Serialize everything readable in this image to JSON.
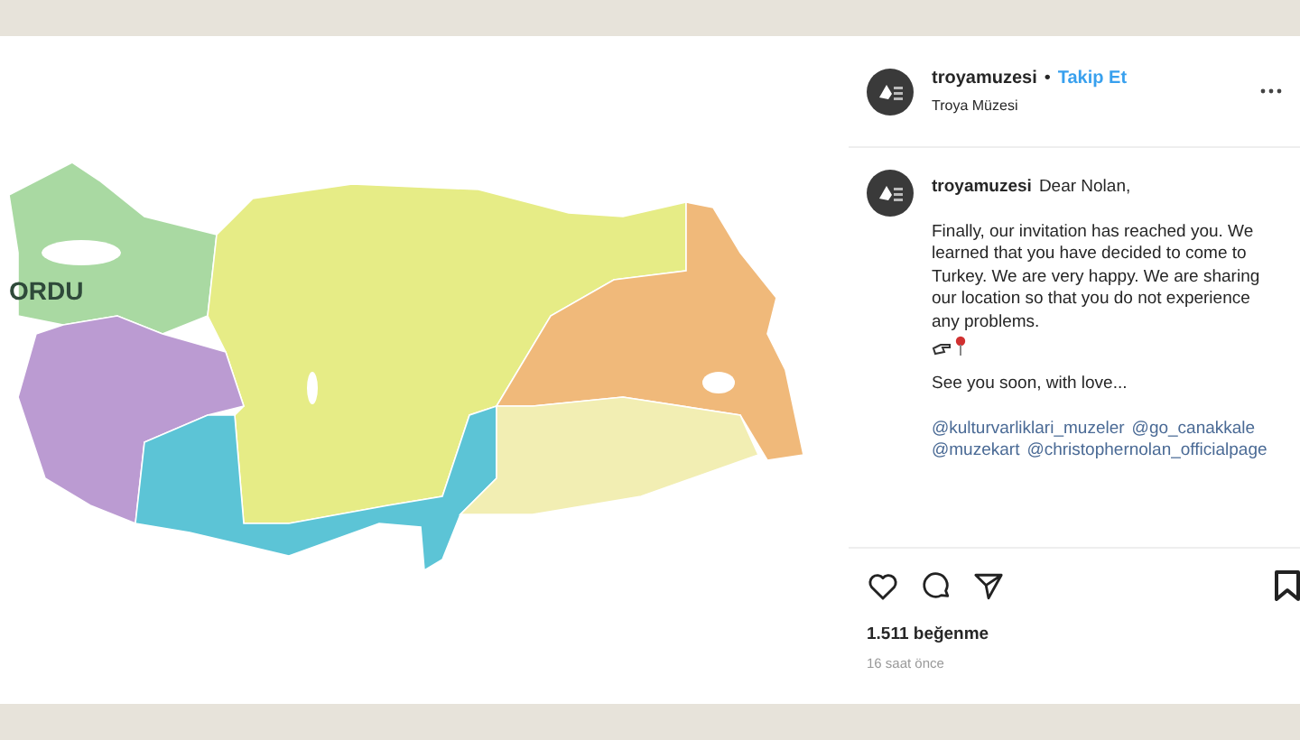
{
  "map": {
    "label": "ORDU"
  },
  "header": {
    "username": "troyamuzesi",
    "separator": "•",
    "follow": "Takip Et",
    "subtitle": "Troya Müzesi"
  },
  "caption": {
    "username": "troyamuzesi",
    "greeting": "Dear Nolan,",
    "body": "Finally, our invitation has reached you. We learned that you have decided to come to Turkey. We are very happy. We are sharing our location so that you do not experience any problems.",
    "closing": "See you soon, with love...",
    "mentions": [
      "@kulturvarliklari_muzeler",
      "@go_canakkale",
      "@muzekart",
      "@christophernolan_officialpage"
    ]
  },
  "likes": "1.511 beğenme",
  "time": "16 saat önce"
}
